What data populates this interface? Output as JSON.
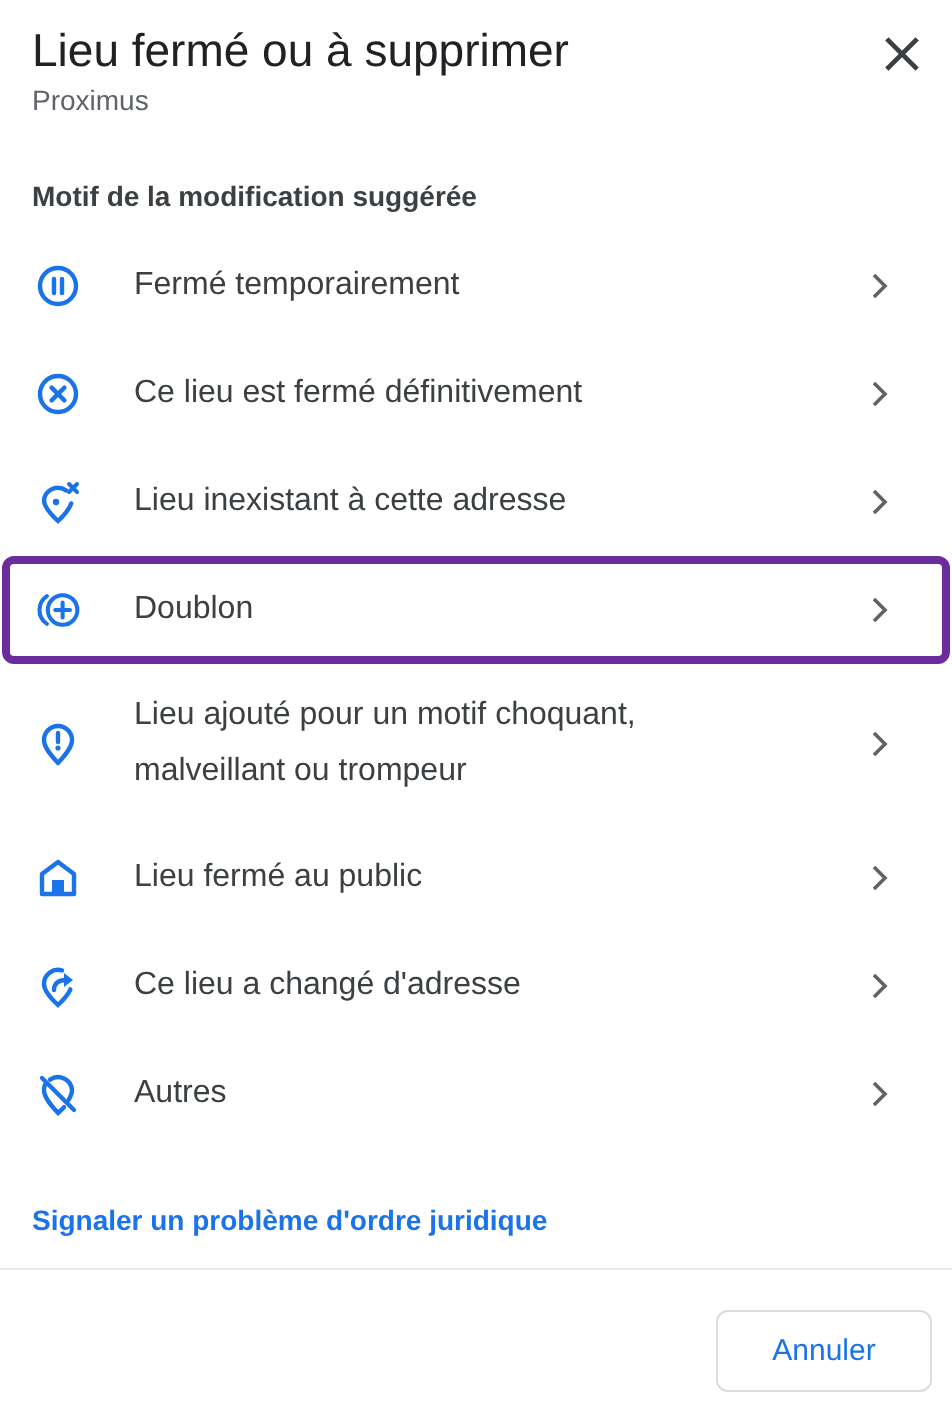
{
  "dialog": {
    "title": "Lieu fermé ou à supprimer",
    "subtitle": "Proximus"
  },
  "section_label": "Motif de la modification suggérée",
  "reasons": [
    {
      "kind": "pause",
      "label": "Fermé temporairement",
      "selected": false
    },
    {
      "kind": "cancel",
      "label": "Ce lieu est fermé définitivement",
      "selected": false
    },
    {
      "kind": "pin-x",
      "label": "Lieu inexistant à cette adresse",
      "selected": false
    },
    {
      "kind": "duplicate",
      "label": "Doublon",
      "selected": true
    },
    {
      "kind": "pin-alert",
      "label": "Lieu ajouté pour un motif choquant, malveillant ou trompeur",
      "selected": false
    },
    {
      "kind": "home",
      "label": "Lieu fermé au public",
      "selected": false
    },
    {
      "kind": "pin-arrow",
      "label": "Ce lieu a changé d'adresse",
      "selected": false
    },
    {
      "kind": "pin-off",
      "label": "Autres",
      "selected": false
    }
  ],
  "legal_link": "Signaler un problème d'ordre juridique",
  "buttons": [
    "Annuler"
  ]
}
